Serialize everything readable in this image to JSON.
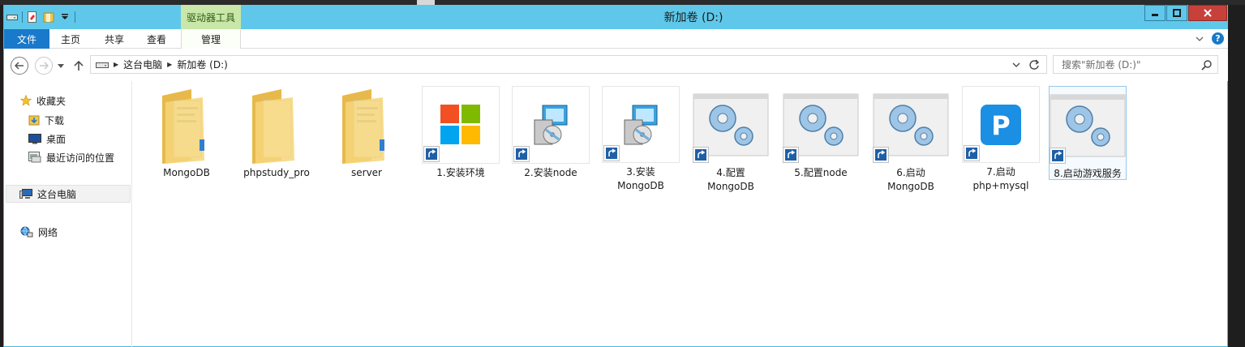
{
  "window": {
    "title": "新加卷 (D:)",
    "context_tab_group": "驱动器工具"
  },
  "ribbon": {
    "tabs": [
      {
        "label": "文件"
      },
      {
        "label": "主页"
      },
      {
        "label": "共享"
      },
      {
        "label": "查看"
      },
      {
        "label": "管理"
      }
    ]
  },
  "address": {
    "crumbs": [
      "这台电脑",
      "新加卷 (D:)"
    ],
    "search_placeholder": "搜索\"新加卷 (D:)\""
  },
  "navpane": {
    "favorites": "收藏夹",
    "downloads": "下载",
    "desktop": "桌面",
    "recent": "最近访问的位置",
    "this_pc": "这台电脑",
    "network": "网络"
  },
  "items": [
    {
      "label": "MongoDB",
      "type": "folder"
    },
    {
      "label": "phpstudy_pro",
      "type": "folder"
    },
    {
      "label": "server",
      "type": "folder"
    },
    {
      "label": "1.安装环境",
      "type": "shortcut-windows"
    },
    {
      "label": "2.安装node",
      "type": "shortcut-installer"
    },
    {
      "label": "3.安装\nMongoDB",
      "type": "shortcut-installer"
    },
    {
      "label": "4.配置\nMongoDB",
      "type": "shortcut-gears"
    },
    {
      "label": "5.配置node",
      "type": "shortcut-gears"
    },
    {
      "label": "6.启动\nMongoDB",
      "type": "shortcut-gears"
    },
    {
      "label": "7.启动\nphp+mysql",
      "type": "shortcut-p"
    },
    {
      "label": "8.启动游戏服务",
      "type": "shortcut-gears"
    }
  ],
  "colors": {
    "titlebar": "#5fc8ea",
    "file_tab": "#1979ca",
    "context_tab": "#c8e7a8",
    "close_button": "#c7413a"
  }
}
